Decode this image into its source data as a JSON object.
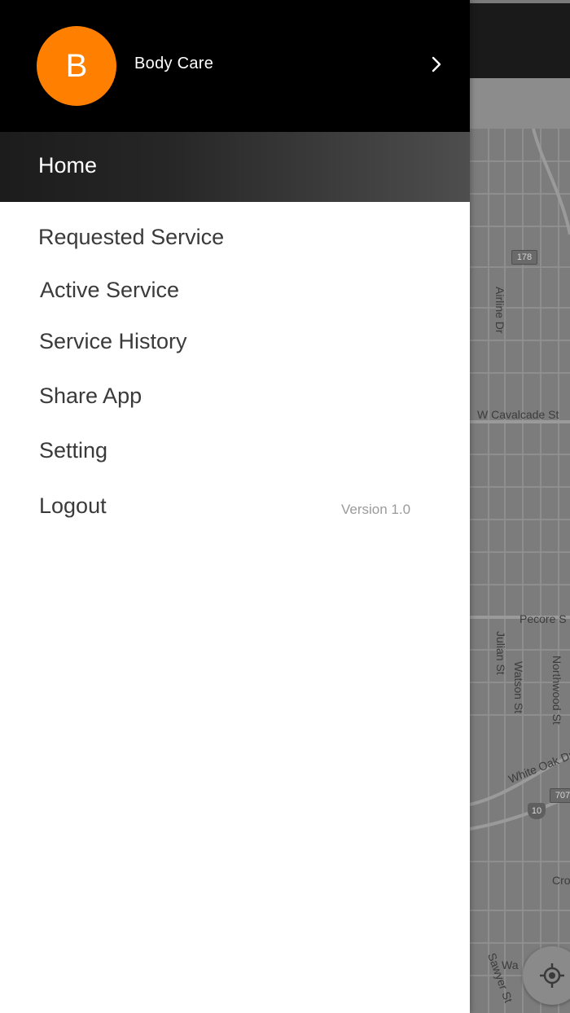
{
  "profile": {
    "avatar_letter": "B",
    "name": "Body Care",
    "chevron_icon": "chevron-right-icon"
  },
  "menu": {
    "home_label": "Home",
    "items": [
      {
        "label": "Requested Service"
      },
      {
        "label": "Active Service"
      },
      {
        "label": "Service History"
      },
      {
        "label": "Share App"
      },
      {
        "label": "Setting"
      },
      {
        "label": "Logout"
      }
    ],
    "version": "Version 1.0"
  },
  "map": {
    "labels": {
      "airline": "Airline Dr",
      "cavalcade": "W Cavalcade St",
      "pecore": "Pecore S",
      "julian": "Julian St",
      "watson": "Watson St",
      "northwood": "Northwood St",
      "white_oak": "White Oak Dr",
      "cro": "Cro",
      "wa": "Wa",
      "sawyer": "Sawyer St"
    },
    "shields": {
      "route_178": "178",
      "route_707": "707",
      "interstate_10": "10"
    },
    "locate_icon": "crosshair-icon"
  },
  "colors": {
    "accent": "#ff7f00",
    "header_bg": "#000000",
    "drawer_bg": "#ffffff",
    "menu_text": "#3a3a3a"
  }
}
